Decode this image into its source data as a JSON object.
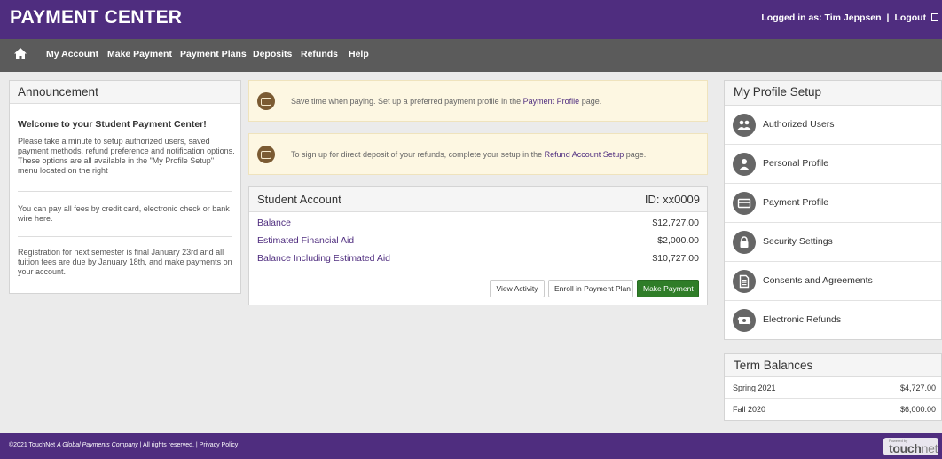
{
  "header": {
    "brand": "PAYMENT CENTER",
    "logged_in_label": "Logged in as: Tim Jeppsen",
    "separator": "|",
    "logout_label": "Logout"
  },
  "nav": {
    "items": [
      "My Account",
      "Make Payment",
      "Payment Plans",
      "Deposits",
      "Refunds",
      "Help"
    ]
  },
  "announcement": {
    "title": "Announcement",
    "welcome": "Welcome to your Student Payment Center!",
    "p1": "Please take a minute to setup authorized users, saved payment methods, refund preference and notification options. These options are all available in the \"My Profile Setup\" menu located on the right",
    "p2": "You can pay all fees by credit card, electronic check or bank wire here.",
    "p3": "Registration for next semester is final January 23rd and all tuition fees are due by January 18th, and make payments on your account."
  },
  "notices": [
    {
      "before": "Save time when paying. Set up a preferred payment profile in the ",
      "link": "Payment Profile",
      "after": " page."
    },
    {
      "before": "To sign up for direct deposit of your refunds, complete your setup in the ",
      "link": "Refund Account Setup",
      "after": " page."
    }
  ],
  "account": {
    "title": "Student Account",
    "id": "ID: xx0009",
    "rows": [
      {
        "label": "Balance",
        "value": "$12,727.00"
      },
      {
        "label": "Estimated Financial Aid",
        "value": "$2,000.00"
      },
      {
        "label": "Balance Including Estimated Aid",
        "value": "$10,727.00"
      }
    ],
    "buttons": {
      "view_activity": "View Activity",
      "enroll_plan": "Enroll in Payment Plan",
      "make_payment": "Make Payment"
    }
  },
  "profile": {
    "title": "My Profile Setup",
    "items": [
      {
        "label": "Authorized Users",
        "icon": "users-icon"
      },
      {
        "label": "Personal Profile",
        "icon": "person-icon"
      },
      {
        "label": "Payment Profile",
        "icon": "credit-card-icon"
      },
      {
        "label": "Security Settings",
        "icon": "lock-icon"
      },
      {
        "label": "Consents and Agreements",
        "icon": "document-icon"
      },
      {
        "label": "Electronic Refunds",
        "icon": "refund-icon"
      }
    ]
  },
  "terms": {
    "title": "Term Balances",
    "rows": [
      {
        "name": "Spring 2021",
        "value": "$4,727.00"
      },
      {
        "name": "Fall 2020",
        "value": "$6,000.00"
      }
    ]
  },
  "footer": {
    "copyright": "©2021 TouchNet",
    "company": "A Global Payments Company",
    "rights": "| All rights reserved. |",
    "privacy": "Privacy Policy",
    "logo_small": "Powered by",
    "logo_touch": "touch",
    "logo_net": "net"
  },
  "colors": {
    "brand_purple": "#4f2d7f",
    "nav_gray": "#5b5b5b",
    "notice_bg": "#fdf7e2",
    "primary_green": "#2f7d28",
    "icon_gray": "#666666"
  }
}
